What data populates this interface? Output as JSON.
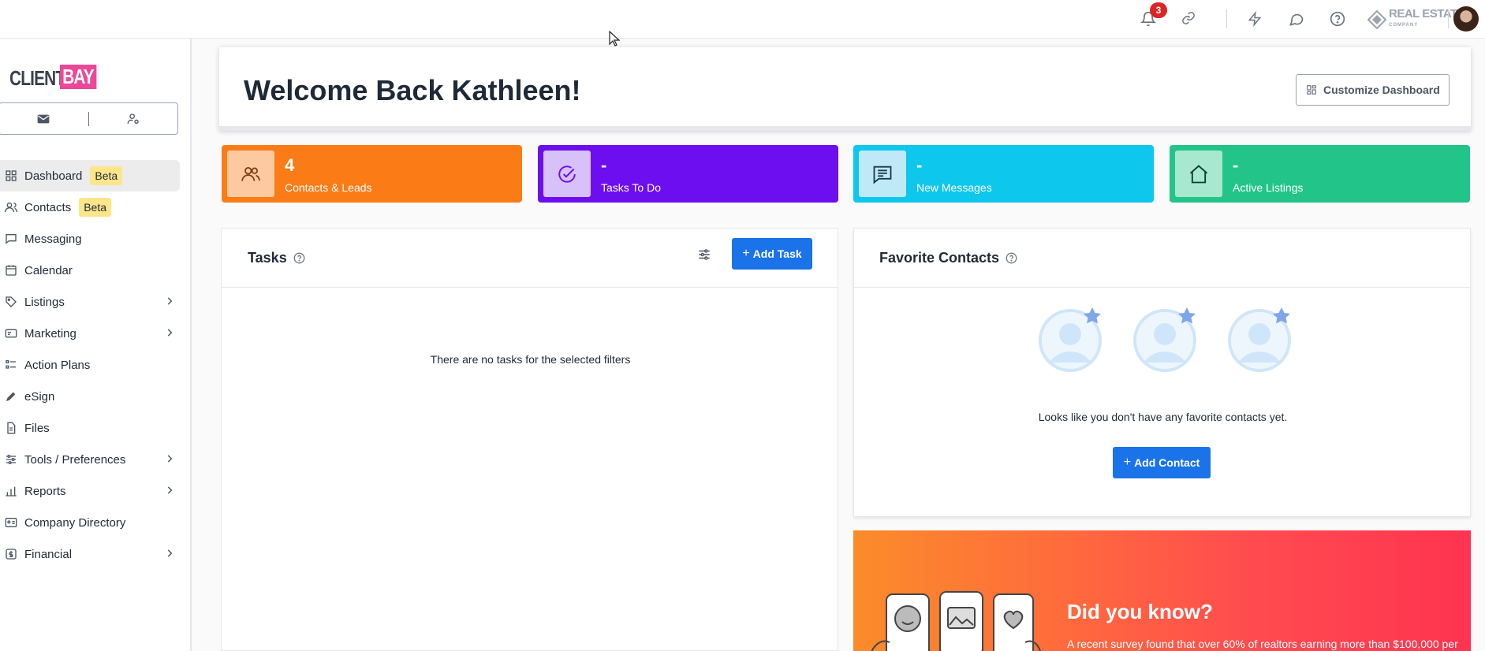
{
  "topbar": {
    "notification_count": "3",
    "brand_name": "REAL ESTATE",
    "brand_sub": "COMPANY"
  },
  "sidebar": {
    "logo_left": "CLIENT",
    "logo_right": "BAY",
    "items": [
      {
        "label": "Dashboard",
        "badge": "Beta",
        "icon": "grid-icon"
      },
      {
        "label": "Contacts",
        "badge": "Beta",
        "icon": "users-icon"
      },
      {
        "label": "Messaging",
        "icon": "chat-icon"
      },
      {
        "label": "Calendar",
        "icon": "calendar-icon"
      },
      {
        "label": "Listings",
        "icon": "tag-icon",
        "expandable": true
      },
      {
        "label": "Marketing",
        "icon": "megaphone-icon",
        "expandable": true
      },
      {
        "label": "Action Plans",
        "icon": "list-icon"
      },
      {
        "label": "eSign",
        "icon": "pen-icon"
      },
      {
        "label": "Files",
        "icon": "file-icon"
      },
      {
        "label": "Tools / Preferences",
        "icon": "sliders-icon",
        "expandable": true
      },
      {
        "label": "Reports",
        "icon": "bar-chart-icon",
        "expandable": true
      },
      {
        "label": "Company Directory",
        "icon": "id-card-icon"
      },
      {
        "label": "Financial",
        "icon": "dollar-icon",
        "expandable": true
      }
    ]
  },
  "welcome": {
    "title": "Welcome Back Kathleen!",
    "customize_label": "Customize Dashboard"
  },
  "stats": [
    {
      "value": "4",
      "label": "Contacts & Leads",
      "color": "#fb7c17",
      "icon_bg": "#fdc9a0",
      "icon": "users-icon"
    },
    {
      "value": "-",
      "label": "Tasks To Do",
      "color": "#6d0ef0",
      "icon_bg": "#d6c1f8",
      "icon": "check-circle-icon"
    },
    {
      "value": "-",
      "label": "New Messages",
      "color": "#0ec7ec",
      "icon_bg": "#bfe9f7",
      "icon": "message-icon"
    },
    {
      "value": "-",
      "label": "Active Listings",
      "color": "#22c48a",
      "icon_bg": "#a8e8d0",
      "icon": "home-icon"
    }
  ],
  "tasks": {
    "title": "Tasks",
    "add_label": "Add Task",
    "empty": "There are no tasks for the selected filters"
  },
  "favorites": {
    "title": "Favorite Contacts",
    "empty": "Looks like you don't have any favorite contacts yet.",
    "add_label": "Add Contact"
  },
  "did_you_know": {
    "title": "Did you know?",
    "text": "A recent survey found that over 60% of realtors earning more than $100,000 per"
  }
}
